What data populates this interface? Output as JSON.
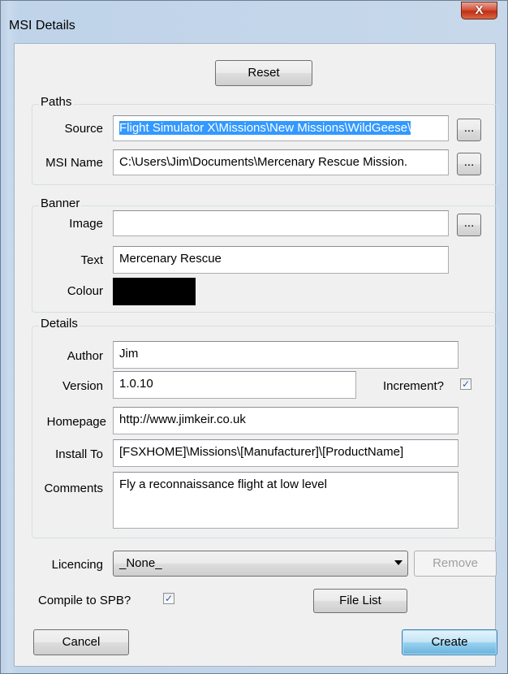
{
  "window": {
    "title": "MSI Details",
    "close_label": "X"
  },
  "reset_label": "Reset",
  "paths": {
    "group_label": "Paths",
    "source_label": "Source",
    "source_value": "Flight Simulator X\\Missions\\New Missions\\WildGeese\\",
    "msi_name_label": "MSI Name",
    "msi_name_value": "C:\\Users\\Jim\\Documents\\Mercenary Rescue Mission.",
    "browse_label": "..."
  },
  "banner": {
    "group_label": "Banner",
    "image_label": "Image",
    "image_value": "",
    "text_label": "Text",
    "text_value": "Mercenary Rescue",
    "colour_label": "Colour",
    "colour_value": "#000000"
  },
  "details": {
    "group_label": "Details",
    "author_label": "Author",
    "author_value": "Jim",
    "version_label": "Version",
    "version_value": "1.0.10",
    "increment_label": "Increment?",
    "increment_checked": true,
    "homepage_label": "Homepage",
    "homepage_value": "http://www.jimkeir.co.uk",
    "install_label": "Install To",
    "install_value": "[FSXHOME]\\Missions\\[Manufacturer]\\[ProductName]",
    "comments_label": "Comments",
    "comments_value": "Fly a reconnaissance flight at low level"
  },
  "licencing": {
    "label": "Licencing",
    "selected": "_None_",
    "remove_label": "Remove"
  },
  "compile": {
    "label": "Compile to SPB?",
    "checked": true
  },
  "file_list_label": "File List",
  "cancel_label": "Cancel",
  "create_label": "Create",
  "check_glyph": "✓"
}
